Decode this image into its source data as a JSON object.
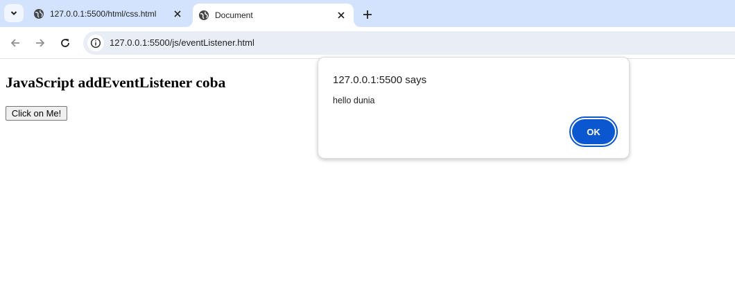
{
  "browser": {
    "tabs": [
      {
        "title": "127.0.0.1:5500/html/css.html",
        "active": false
      },
      {
        "title": "Document",
        "active": true
      }
    ],
    "url": "127.0.0.1:5500/js/eventListener.html"
  },
  "page": {
    "heading": "JavaScript addEventListener coba",
    "button_label": "Click on Me!"
  },
  "alert": {
    "title": "127.0.0.1:5500 says",
    "message": "hello dunia",
    "ok_label": "OK"
  },
  "colors": {
    "tabstrip": "#d3e3fd",
    "omnibox": "#e9eef6",
    "accent": "#0b57d0"
  }
}
